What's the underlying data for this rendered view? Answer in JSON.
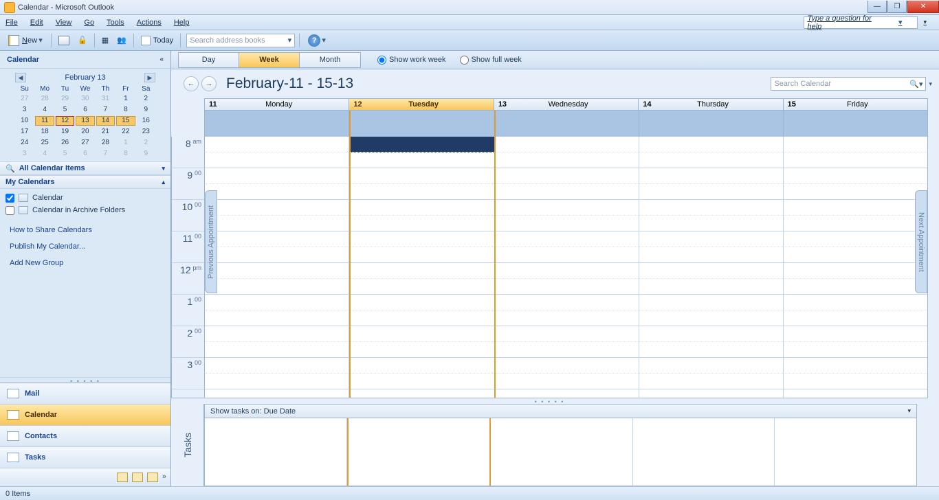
{
  "window_title": "Calendar - Microsoft Outlook",
  "menu": [
    "File",
    "Edit",
    "View",
    "Go",
    "Tools",
    "Actions",
    "Help"
  ],
  "help_placeholder": "Type a question for help",
  "toolbar": {
    "new_label": "New",
    "today_label": "Today",
    "addr_placeholder": "Search address books"
  },
  "sidebar": {
    "header": "Calendar",
    "minicalendar": {
      "label": "February 13",
      "dow": [
        "Su",
        "Mo",
        "Tu",
        "We",
        "Th",
        "Fr",
        "Sa"
      ]
    },
    "all_items": "All Calendar Items",
    "my_calendars": "My Calendars",
    "calendars": [
      {
        "label": "Calendar",
        "checked": true
      },
      {
        "label": "Calendar in Archive Folders",
        "checked": false
      }
    ],
    "links": [
      "How to Share Calendars",
      "Publish My Calendar...",
      "Add New Group"
    ],
    "nav": [
      {
        "label": "Mail",
        "active": false
      },
      {
        "label": "Calendar",
        "active": true
      },
      {
        "label": "Contacts",
        "active": false
      },
      {
        "label": "Tasks",
        "active": false
      }
    ]
  },
  "view": {
    "tabs": [
      "Day",
      "Week",
      "Month"
    ],
    "active_tab": "Week",
    "radios": [
      {
        "label": "Show work week",
        "checked": true
      },
      {
        "label": "Show full week",
        "checked": false
      }
    ],
    "date_title": "February-11 - 15-13",
    "search_placeholder": "Search Calendar",
    "days": [
      {
        "num": "11",
        "name": "Monday",
        "today": false
      },
      {
        "num": "12",
        "name": "Tuesday",
        "today": true
      },
      {
        "num": "13",
        "name": "Wednesday",
        "today": false
      },
      {
        "num": "14",
        "name": "Thursday",
        "today": false
      },
      {
        "num": "15",
        "name": "Friday",
        "today": false
      }
    ],
    "time_slots": [
      {
        "hr": "8",
        "suf": "am"
      },
      {
        "hr": "9",
        "suf": "00"
      },
      {
        "hr": "10",
        "suf": "00"
      },
      {
        "hr": "11",
        "suf": "00"
      },
      {
        "hr": "12",
        "suf": "pm"
      },
      {
        "hr": "1",
        "suf": "00"
      },
      {
        "hr": "2",
        "suf": "00"
      },
      {
        "hr": "3",
        "suf": "00"
      }
    ],
    "prev_appt": "Previous Appointment",
    "next_appt": "Next Appointment"
  },
  "tasks": {
    "label": "Tasks",
    "header": "Show tasks on: Due Date"
  },
  "status": "0 Items"
}
